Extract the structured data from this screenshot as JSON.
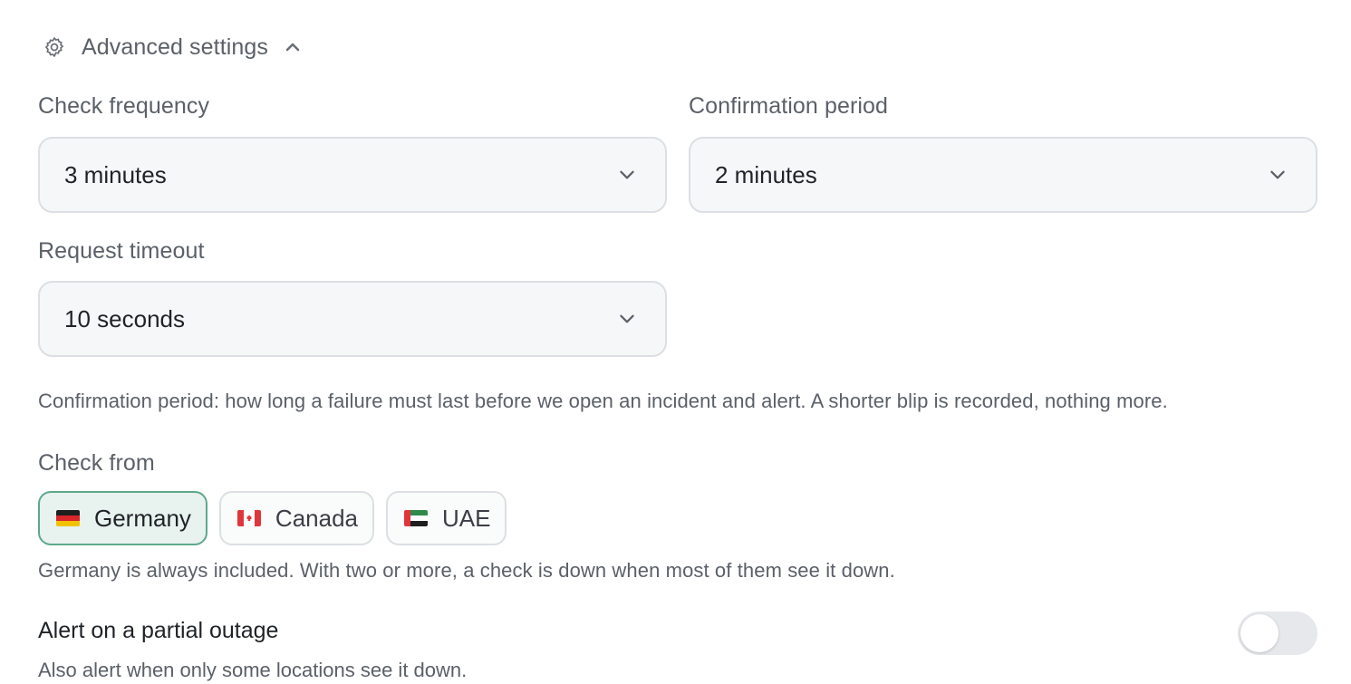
{
  "advanced": {
    "title": "Advanced settings",
    "gear_icon": "gear-icon",
    "toggle_icon": "chevron-up-icon"
  },
  "check_frequency": {
    "label": "Check frequency",
    "value": "3 minutes"
  },
  "confirmation_period": {
    "label": "Confirmation period",
    "value": "2 minutes"
  },
  "request_timeout": {
    "label": "Request timeout",
    "value": "10 seconds"
  },
  "confirmation_help": "Confirmation period: how long a failure must last before we open an incident and alert. A shorter blip is recorded, nothing more.",
  "check_from": {
    "label": "Check from",
    "locations": [
      {
        "name": "Germany",
        "selected": true,
        "flag_icon": "germany-flag-icon"
      },
      {
        "name": "Canada",
        "selected": false,
        "flag_icon": "canada-flag-icon"
      },
      {
        "name": "UAE",
        "selected": false,
        "flag_icon": "uae-flag-icon"
      }
    ],
    "help": "Germany is always included. With two or more, a check is down when most of them see it down."
  },
  "partial_outage": {
    "title": "Alert on a partial outage",
    "description": "Also alert when only some locations see it down.",
    "enabled": false
  },
  "colors": {
    "selected_chip_bg": "#e8f2ee",
    "selected_chip_border": "#5fa88c",
    "select_bg": "#f6f7f8",
    "muted_text": "#5b6068"
  }
}
